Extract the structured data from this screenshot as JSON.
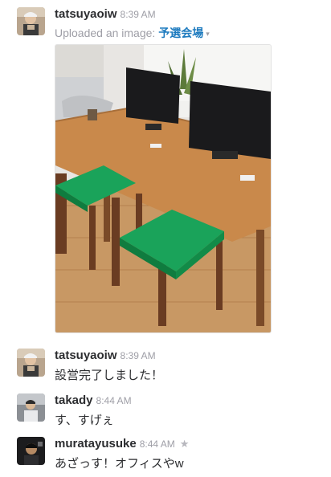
{
  "messages": [
    {
      "user": "tatsuyaoiw",
      "time": "8:39 AM",
      "upload_prefix": "Uploaded an image:",
      "upload_title": "予選会場",
      "caret": "▾",
      "image_alt": "Photo of a wooden table with two monitors and two chairs with green cushions"
    },
    {
      "user": "tatsuyaoiw",
      "time": "8:39 AM",
      "text": "設営完了しました！"
    },
    {
      "user": "takady",
      "time": "8:44 AM",
      "text": "す、すげぇ"
    },
    {
      "user": "muratayusuke",
      "time": "8:44 AM",
      "star": "★",
      "text": "あざっす！オフィスやw"
    }
  ],
  "colors": {
    "link": "#1e7bbf",
    "meta": "#9e9ea6",
    "text": "#2c2d30",
    "cushion": "#15a050"
  }
}
